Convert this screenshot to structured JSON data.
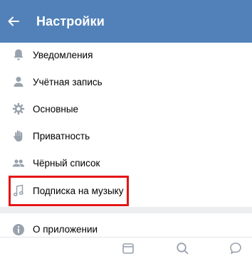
{
  "header": {
    "title": "Настройки",
    "back_icon": "arrow-left-icon",
    "bg_color": "#5181b8"
  },
  "menu": {
    "items": [
      {
        "label": "Уведомления",
        "icon": "bell-icon"
      },
      {
        "label": "Учётная запись",
        "icon": "user-icon"
      },
      {
        "label": "Основные",
        "icon": "gear-icon"
      },
      {
        "label": "Приватность",
        "icon": "hand-icon"
      },
      {
        "label": "Чёрный список",
        "icon": "users-icon"
      },
      {
        "label": "Подписка на музыку",
        "icon": "music-note-icon",
        "highlighted": true
      }
    ],
    "about": {
      "label": "О приложении",
      "icon": "info-icon"
    }
  },
  "tabbar": {
    "tabs": [
      {
        "icon": "calendar-icon"
      },
      {
        "icon": "search-icon"
      },
      {
        "icon": "chat-bubble-icon"
      }
    ]
  },
  "colors": {
    "icon_gray": "#99a2ad",
    "highlight_border": "#e41616",
    "divider": "#edeef0"
  }
}
